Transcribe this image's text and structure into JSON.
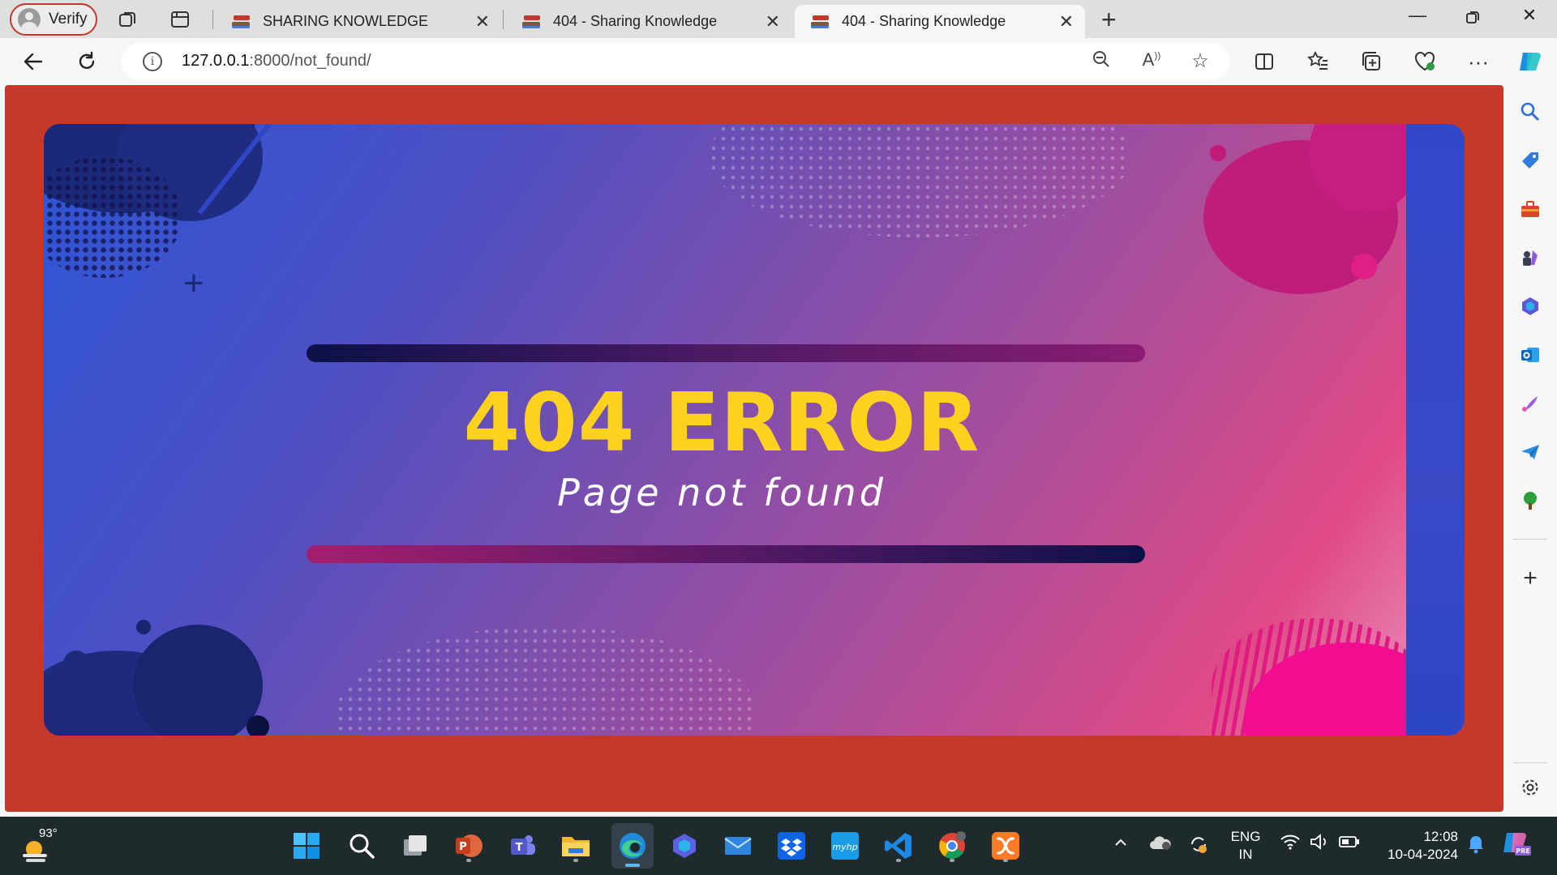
{
  "browser": {
    "profile_label": "Verify",
    "tabs": [
      {
        "title": "SHARING KNOWLEDGE",
        "active": false
      },
      {
        "title": "404 - Sharing Knowledge",
        "active": false
      },
      {
        "title": "404 - Sharing Knowledge",
        "active": true
      }
    ],
    "address": {
      "host": "127.0.0.1",
      "rest": ":8000/not_found/"
    }
  },
  "page": {
    "headline": "404 ERROR",
    "subline": "Page not found"
  },
  "taskbar": {
    "weather_temp": "93°",
    "language": {
      "line1": "ENG",
      "line2": "IN"
    },
    "clock": {
      "time": "12:08",
      "date": "10-04-2024"
    }
  },
  "colors": {
    "page_background": "#c6392a",
    "headline": "#fcd21e",
    "profile_border": "#c0392b"
  }
}
